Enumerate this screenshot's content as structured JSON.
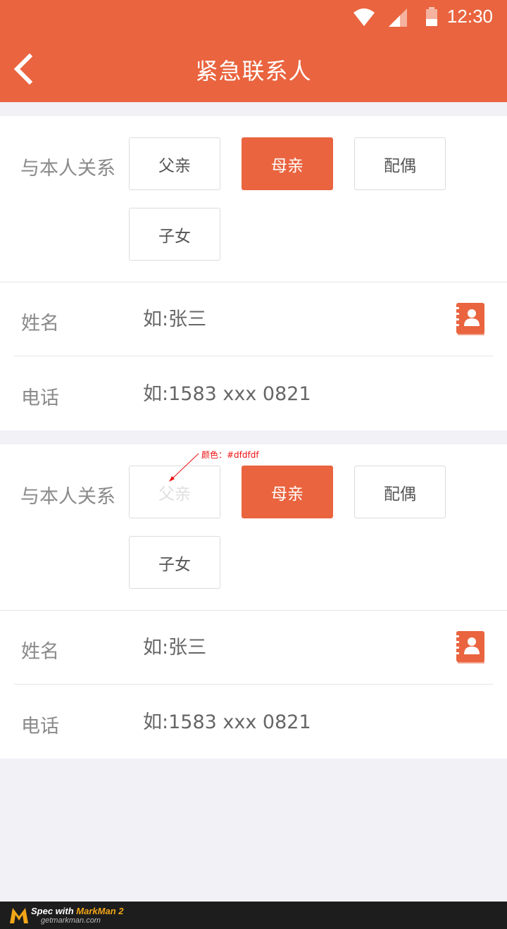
{
  "status_bar": {
    "time": "12:30"
  },
  "header": {
    "title": "紧急联系人"
  },
  "contacts": [
    {
      "relation_label": "与本人关系",
      "relations": [
        "父亲",
        "母亲",
        "配偶",
        "子女"
      ],
      "selected": "母亲",
      "name_label": "姓名",
      "name_placeholder": "如:张三",
      "phone_label": "电话",
      "phone_placeholder": "如:1583 xxx 0821"
    },
    {
      "relation_label": "与本人关系",
      "relations": [
        "父亲",
        "母亲",
        "配偶",
        "子女"
      ],
      "selected": "母亲",
      "name_label": "姓名",
      "name_placeholder": "如:张三",
      "phone_label": "电话",
      "phone_placeholder": "如:1583 xxx 0821"
    }
  ],
  "annotation": {
    "text": "颜色：#dfdfdf"
  },
  "footer": {
    "spec_prefix": "Spec with ",
    "brand": "MarkMan 2",
    "url": "getmarkman.com"
  },
  "colors": {
    "accent": "#e9643f",
    "background": "#f1f1f6",
    "dim_text": "#dfdfdf"
  },
  "icons": {
    "back": "chevron-left-icon",
    "contacts": "address-book-icon"
  }
}
